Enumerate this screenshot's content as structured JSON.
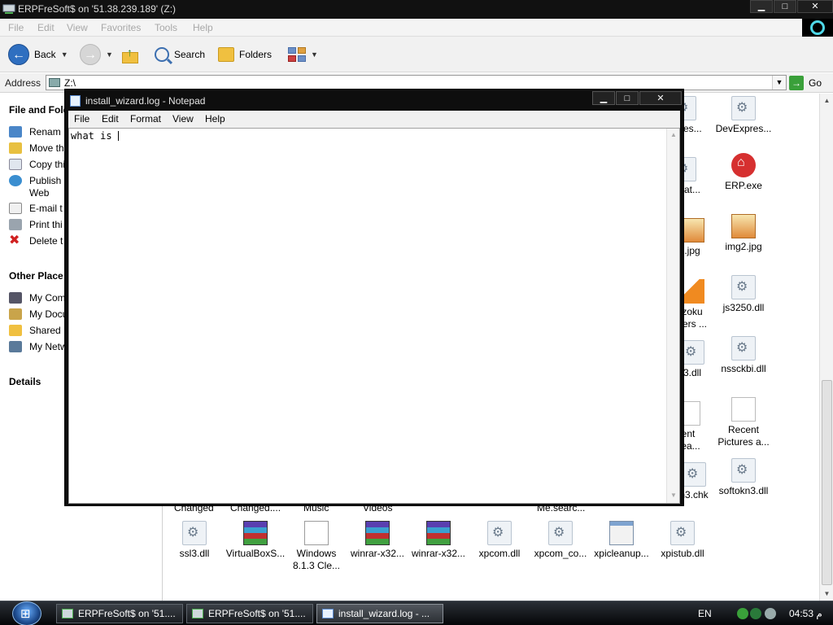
{
  "explorer": {
    "title": "ERPFreSoft$ on '51.38.239.189' (Z:)",
    "caption": {
      "minimize": "▁",
      "maximize": "□",
      "close": "✕"
    },
    "menu": [
      "File",
      "Edit",
      "View",
      "Favorites",
      "Tools",
      "Help"
    ],
    "toolbar": {
      "back": "Back",
      "search": "Search",
      "folders": "Folders"
    },
    "address": {
      "label": "Address",
      "value": "Z:\\",
      "go": "Go"
    },
    "taskpane": {
      "file_tasks_title": "File and Fold",
      "file_tasks": [
        "Renam",
        "Move thi",
        "Copy thi",
        "Publish",
        "Web",
        "E-mail t",
        "Print thi",
        "Delete t"
      ],
      "other_places_title": "Other Place",
      "other_places": [
        "My Com",
        "My Docu",
        "Shared",
        "My Netw"
      ],
      "details_title": "Details"
    },
    "files_right": [
      {
        "name": "...pres...",
        "icon": "dll-icon"
      },
      {
        "name": "DevExpres...",
        "icon": "dll-icon"
      },
      {
        "name": "...mat...",
        "icon": "dll-icon"
      },
      {
        "name": "ERP.exe",
        "icon": "erp-icon"
      },
      {
        "name": ".jpg",
        "icon": "jpg-icon"
      },
      {
        "name": "img2.jpg",
        "icon": "jpg-icon"
      },
      {
        "name": "zoku",
        "name2": "vers ...",
        "icon": "vlc-icon"
      },
      {
        "name": "js3250.dll",
        "icon": "dll-icon"
      },
      {
        "name": "3.dll",
        "icon": "dll-icon"
      },
      {
        "name": "nssckbi.dll",
        "icon": "dll-icon"
      },
      {
        "name": "ent",
        "name2": "sea...",
        "icon": "blank-icon"
      },
      {
        "name": "Recent",
        "name2": "Pictures a...",
        "icon": "blank-icon"
      },
      {
        "name": "n3.chk",
        "icon": "dll-icon"
      },
      {
        "name": "softokn3.dll",
        "icon": "dll-icon"
      }
    ],
    "files_partial_row": [
      "Changed",
      "Changed....",
      "Music",
      "Videos",
      "Me.searc..."
    ],
    "files_bottom": [
      {
        "name": "ssl3.dll",
        "icon": "dll-icon"
      },
      {
        "name": "VirtualBoxS...",
        "icon": "rar-icon"
      },
      {
        "name": "Windows",
        "name2": "8.1.3 Cle...",
        "icon": "txt-icon"
      },
      {
        "name": "winrar-x32...",
        "icon": "rar-icon"
      },
      {
        "name": "winrar-x32...",
        "icon": "rar-icon"
      },
      {
        "name": "xpcom.dll",
        "icon": "dll-icon"
      },
      {
        "name": "xpcom_co...",
        "icon": "dll-icon"
      },
      {
        "name": "xpicleanup...",
        "icon": "win-icon"
      },
      {
        "name": "xpistub.dll",
        "icon": "dll-icon"
      }
    ]
  },
  "notepad": {
    "title": "install_wizard.log - Notepad",
    "caption": {
      "minimize": "▁",
      "maximize": "□",
      "close": "✕"
    },
    "menu": [
      "File",
      "Edit",
      "Format",
      "View",
      "Help"
    ],
    "content": "what is "
  },
  "taskbar": {
    "buttons": [
      "ERPFreSoft$ on '51....",
      "ERPFreSoft$ on '51....",
      "install_wizard.log - ..."
    ],
    "active_index": 2,
    "language": "EN",
    "clock": "04:53 م"
  },
  "colors": {
    "titlebar": "#111111",
    "taskbar": "#050608",
    "accent_blue": "#2f6fc0",
    "cyan_ring": "#4fd8e8"
  }
}
